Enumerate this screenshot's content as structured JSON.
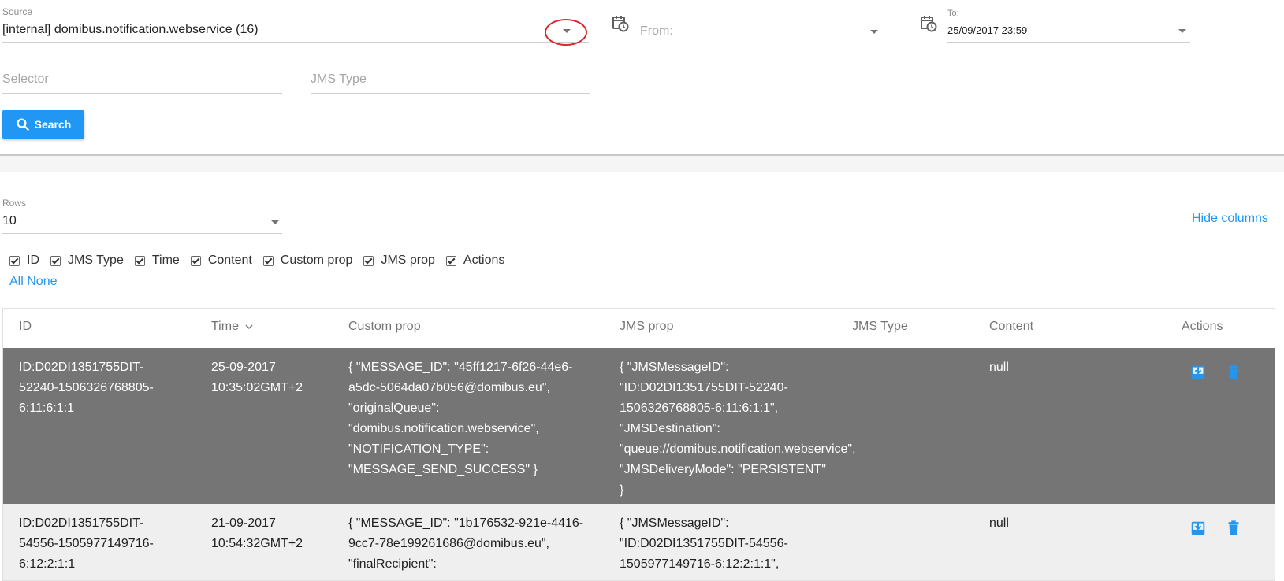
{
  "filters": {
    "source": {
      "label": "Source",
      "value": "[internal] domibus.notification.webservice (16)"
    },
    "from": {
      "placeholder": "From:"
    },
    "to": {
      "label": "To:",
      "value": "25/09/2017 23:59"
    },
    "selector": {
      "placeholder": "Selector"
    },
    "jms_type": {
      "placeholder": "JMS Type"
    },
    "search_label": "Search"
  },
  "rows_select": {
    "label": "Rows",
    "value": "10"
  },
  "hide_columns_label": "Hide columns",
  "column_toggles": [
    "ID",
    "JMS Type",
    "Time",
    "Content",
    "Custom prop",
    "JMS prop",
    "Actions"
  ],
  "toggle_links": {
    "all": "All",
    "none": "None"
  },
  "table": {
    "headers": {
      "id": "ID",
      "time": "Time",
      "custom_prop": "Custom prop",
      "jms_prop": "JMS prop",
      "jms_type": "JMS Type",
      "content": "Content",
      "actions": "Actions"
    },
    "rows": [
      {
        "id": "ID:D02DI1351755DIT-\n52240-1506326768805-\n6:11:6:1:1",
        "time": "25-09-2017\n10:35:02GMT+2",
        "custom_prop": "{ \"MESSAGE_ID\": \"45ff1217-6f26-44e6-\na5dc-5064da07b056@domibus.eu\",\n\"originalQueue\":\n\"domibus.notification.webservice\",\n\"NOTIFICATION_TYPE\":\n\"MESSAGE_SEND_SUCCESS\" }",
        "jms_prop": "{ \"JMSMessageID\":\n\"ID:D02DI1351755DIT-52240-\n1506326768805-6:11:6:1:1\",\n\"JMSDestination\":\n\"queue://domibus.notification.webservice\",\n\"JMSDeliveryMode\": \"PERSISTENT\"\n}",
        "jms_type": "",
        "content": "null"
      },
      {
        "id": "ID:D02DI1351755DIT-\n54556-1505977149716-\n6:12:2:1:1",
        "time": "21-09-2017\n10:54:32GMT+2",
        "custom_prop": "{ \"MESSAGE_ID\": \"1b176532-921e-4416-\n9cc7-78e199261686@domibus.eu\",\n\"finalRecipient\":",
        "jms_prop": "{ \"JMSMessageID\":\n\"ID:D02DI1351755DIT-54556-\n1505977149716-6:12:2:1:1\",",
        "jms_type": "",
        "content": "null"
      }
    ]
  },
  "colors": {
    "accent": "#2196f3",
    "selected_row": "#757575",
    "row_bg": "#efefef",
    "highlight_circle": "#d9272e"
  }
}
